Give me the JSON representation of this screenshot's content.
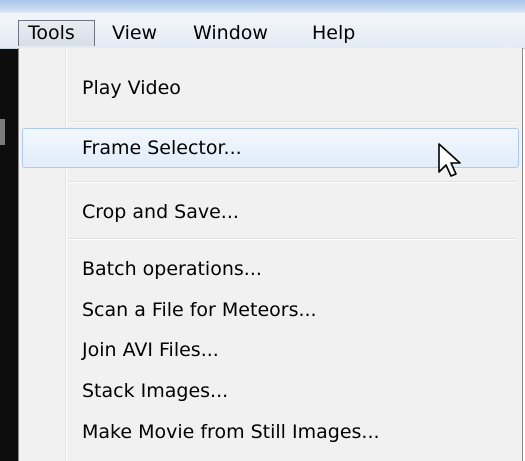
{
  "menubar": {
    "items": [
      {
        "label": "Tools"
      },
      {
        "label": "View"
      },
      {
        "label": "Window"
      },
      {
        "label": "Help"
      }
    ]
  },
  "dropdown": {
    "open_menu": "Tools",
    "items": [
      {
        "label": "Play Video"
      },
      {
        "label": "Frame Selector...",
        "highlighted": true
      },
      {
        "label": "Crop and Save..."
      },
      {
        "label": "Batch operations..."
      },
      {
        "label": "Scan a File for Meteors..."
      },
      {
        "label": "Join AVI Files..."
      },
      {
        "label": "Stack Images..."
      },
      {
        "label": "Make Movie from Still Images..."
      }
    ]
  },
  "colors": {
    "highlight_border": "#a9cbf0",
    "highlight_fill": "#e1edfa",
    "menu_background": "#f1f1f1",
    "menubar_background": "#e4ebf5"
  },
  "cursor": {
    "icon": "arrow-pointer-icon"
  }
}
